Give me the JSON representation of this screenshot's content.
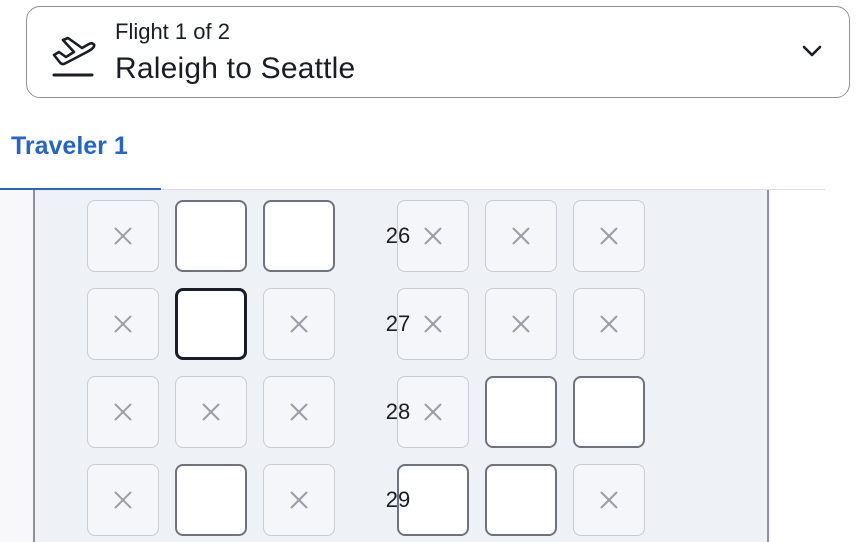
{
  "flight_selector": {
    "subtitle": "Flight 1 of 2",
    "route": "Raleigh to Seattle",
    "icon": "plane-takeoff-icon",
    "dropdown_icon": "chevron-down-icon"
  },
  "tabs": [
    {
      "label": "Traveler 1",
      "active": true
    }
  ],
  "colors": {
    "accent": "#2565c7",
    "fuselage": "#eef1f6",
    "seat_border_available": "#70727e",
    "seat_border_selected": "#1a1c26",
    "seat_unavailable": "#f4f6f9"
  },
  "seat_map": {
    "rows": [
      {
        "number": "26",
        "seats": [
          "unavailable",
          "available",
          "available",
          "unavailable",
          "unavailable",
          "unavailable"
        ]
      },
      {
        "number": "27",
        "seats": [
          "unavailable",
          "selected",
          "unavailable",
          "unavailable",
          "unavailable",
          "unavailable"
        ]
      },
      {
        "number": "28",
        "seats": [
          "unavailable",
          "unavailable",
          "unavailable",
          "unavailable",
          "available",
          "available"
        ]
      },
      {
        "number": "29",
        "seats": [
          "unavailable",
          "available",
          "unavailable",
          "available",
          "available",
          "unavailable"
        ]
      }
    ]
  }
}
